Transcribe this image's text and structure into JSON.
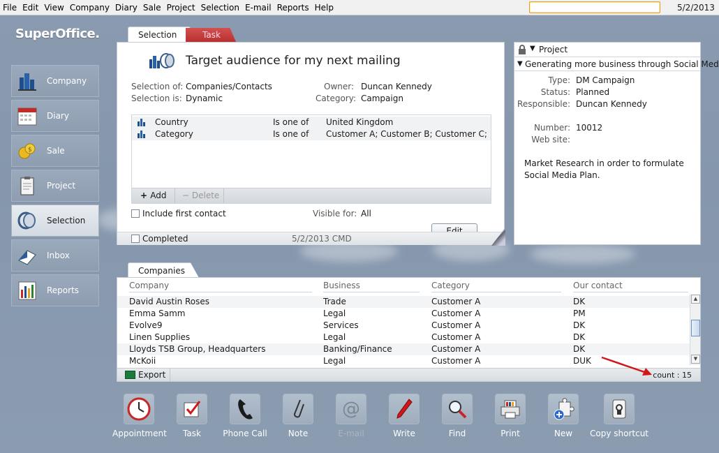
{
  "menubar": {
    "items": [
      "File",
      "Edit",
      "View",
      "Company",
      "Diary",
      "Sale",
      "Project",
      "Selection",
      "E-mail",
      "Reports",
      "Help"
    ],
    "search_value": "",
    "date": "5/2/2013"
  },
  "logo": "SuperOffice.",
  "sidebar": {
    "items": [
      {
        "label": "Company",
        "icon": "company-icon"
      },
      {
        "label": "Diary",
        "icon": "diary-icon"
      },
      {
        "label": "Sale",
        "icon": "sale-icon"
      },
      {
        "label": "Project",
        "icon": "project-icon"
      },
      {
        "label": "Selection",
        "icon": "selection-icon",
        "active": true
      },
      {
        "label": "Inbox",
        "icon": "inbox-icon"
      },
      {
        "label": "Reports",
        "icon": "reports-icon"
      }
    ]
  },
  "selection": {
    "tabs": [
      "Selection",
      "Task"
    ],
    "title": "Target audience for my next mailing",
    "selection_of_label": "Selection of:",
    "selection_of": "Companies/Contacts",
    "selection_is_label": "Selection is:",
    "selection_is": "Dynamic",
    "owner_label": "Owner:",
    "owner": "Duncan Kennedy",
    "category_label": "Category:",
    "category": "Campaign",
    "criteria": [
      {
        "field": "Country",
        "operator": "Is one of",
        "value": "United Kingdom"
      },
      {
        "field": "Category",
        "operator": "Is one of",
        "value": "Customer A; Customer B; Customer C; VIP C"
      }
    ],
    "add_label": "Add",
    "delete_label": "Delete",
    "include_first_contact": "Include first contact",
    "visible_for_label": "Visible for:",
    "visible_for": "All",
    "edit_label": "Edit",
    "completed_label": "Completed",
    "footer_info": "5/2/2013 CMD"
  },
  "project": {
    "header": "Project",
    "name": "Generating more business through Social Medi",
    "fields": [
      {
        "label": "Type:",
        "value": "DM Campaign"
      },
      {
        "label": "Status:",
        "value": "Planned"
      },
      {
        "label": "Responsible:",
        "value": "Duncan Kennedy"
      },
      {
        "label": "Number:",
        "value": "10012"
      },
      {
        "label": "Web site:",
        "value": ""
      }
    ],
    "description": "Market Research in order to formulate Social Media Plan."
  },
  "companies": {
    "tab": "Companies",
    "columns": [
      "Company",
      "Business",
      "Category",
      "Our contact"
    ],
    "rows": [
      [
        "David Austin Roses",
        "Trade",
        "Customer A",
        "DK"
      ],
      [
        "Emma Samm",
        "Legal",
        "Customer A",
        "PM"
      ],
      [
        "Evolve9",
        "Services",
        "Customer A",
        "DK"
      ],
      [
        "Linen Supplies",
        "Legal",
        "Customer A",
        "DK"
      ],
      [
        "Lloyds TSB Group, Headquarters",
        "Banking/Finance",
        "Customer A",
        "DK"
      ],
      [
        "McKoii",
        "Legal",
        "Customer A",
        "DUK"
      ]
    ],
    "export_label": "Export",
    "count": "count : 15"
  },
  "toolbar": {
    "buttons": [
      {
        "label": "Appointment",
        "icon": "clock-icon",
        "enabled": true
      },
      {
        "label": "Task",
        "icon": "task-check-icon",
        "enabled": true
      },
      {
        "label": "Phone Call",
        "icon": "phone-icon",
        "enabled": true
      },
      {
        "label": "Note",
        "icon": "paperclip-icon",
        "enabled": true
      },
      {
        "label": "E-mail",
        "icon": "at-icon",
        "enabled": false
      },
      {
        "label": "Write",
        "icon": "pen-icon",
        "enabled": true
      },
      {
        "label": "Find",
        "icon": "magnifier-icon",
        "enabled": true
      },
      {
        "label": "Print",
        "icon": "printer-icon",
        "enabled": true
      },
      {
        "label": "New",
        "icon": "puzzle-add-icon",
        "enabled": true
      },
      {
        "label": "Copy shortcut",
        "icon": "shortcut-icon",
        "enabled": true
      }
    ]
  }
}
